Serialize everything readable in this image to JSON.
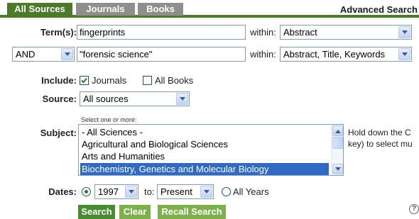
{
  "tabs": [
    {
      "label": "All Sources",
      "active": true
    },
    {
      "label": "Journals",
      "active": false
    },
    {
      "label": "Books",
      "active": false
    }
  ],
  "advanced_search": "Advanced Search",
  "row1": {
    "label": "Term(s):",
    "value": "fingerprints",
    "within_label": "within:",
    "within_value": "Abstract"
  },
  "row2": {
    "operator": "AND",
    "value": "\"forensic science\"",
    "within_label": "within:",
    "within_value": "Abstract, Title, Keywords"
  },
  "include": {
    "label": "Include:",
    "journals_label": "Journals",
    "journals_checked": true,
    "books_label": "All Books",
    "books_checked": false
  },
  "source": {
    "label": "Source:",
    "value": "All sources"
  },
  "subject": {
    "hint": "Select one or more:",
    "label": "Subject:",
    "items": [
      "- All Sciences -",
      "Agricultural and Biological Sciences",
      "Arts and Humanities",
      "Biochemistry, Genetics and Molecular Biology"
    ],
    "selected_index": 3,
    "side_note_line1": "Hold down the C",
    "side_note_line2": "key) to select mu"
  },
  "dates": {
    "label": "Dates:",
    "from_value": "1997",
    "to_label": "to:",
    "to_value": "Present",
    "all_years_label": "All Years",
    "range_selected": true
  },
  "buttons": {
    "search": "Search",
    "clear": "Clear",
    "recall": "Recall Search"
  },
  "help_icon_glyph": "?",
  "colors": {
    "tab_active": "#4a7a2a",
    "tab_inactive": "#8e8e8e",
    "button": "#4a8a32",
    "selection": "#316ac5"
  }
}
